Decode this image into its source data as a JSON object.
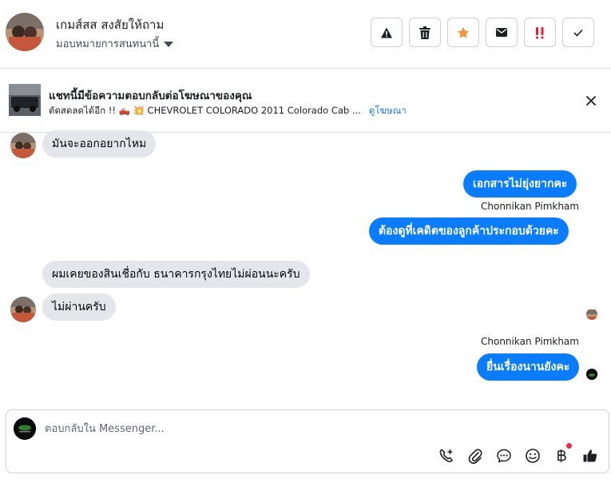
{
  "header": {
    "contact_name": "เกมส์สส สงสัยให้ถาม",
    "assign_label": "มอบหมายการสนทนานี้",
    "actions": [
      "report-spam",
      "delete",
      "star",
      "mark-unread",
      "follow-up",
      "done"
    ]
  },
  "ad": {
    "title": "แชทนี้มีข้อความตอบกลับต่อโฆษณาของคุณ",
    "subtitle": "ตัดสดลดได้อีก !! 🛻 💥 CHEVROLET COLORADO 2011 Colorado Cab ...",
    "link": "ดูโฆษณา"
  },
  "messages": [
    {
      "dir": "in",
      "text": "มันจะออกอยากไหม"
    },
    {
      "dir": "out",
      "text": "เอกสารไม่ยุ่งยากคะ"
    },
    {
      "dir": "out",
      "sender": "Chonnikan Pimkham",
      "text": "ต้องดูที่เคดิตของลูกค้าประกอบด้วยคะ"
    },
    {
      "dir": "in",
      "text": "ผมเคยของสินเชื่อกับ ธนาคารกรุงไทยไม่ผ่อนนะครับ"
    },
    {
      "dir": "in",
      "text": "ไม่ผ่านครับ"
    },
    {
      "dir": "out",
      "sender": "Chonnikan Pimkham",
      "text": "ยื่นเรื่องนานยังคะ"
    }
  ],
  "composer": {
    "placeholder": "ตอบกลับใน Messenger..."
  },
  "colors": {
    "accent": "#0a7cff",
    "incoming": "#e4e6eb",
    "star": "#f7923a",
    "followup": "#e41e3f"
  },
  "icons": [
    "warning-icon",
    "trash-icon",
    "star-icon",
    "envelope-icon",
    "exclamation-icon",
    "check-icon",
    "close-icon",
    "call-add-icon",
    "paperclip-icon",
    "saved-reply-icon",
    "emoji-icon",
    "baht-icon",
    "thumbs-up-icon"
  ]
}
